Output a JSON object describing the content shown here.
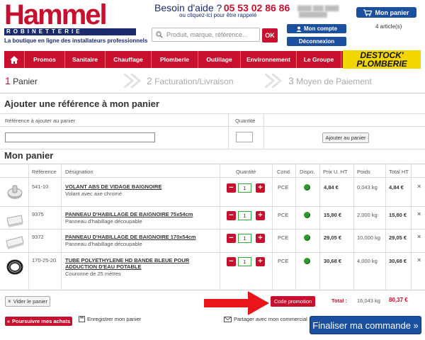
{
  "header": {
    "logo_text": "Hammel",
    "logo_sub": "ROBINETTERIE",
    "tagline": "La boutique en ligne des installateurs professionnels",
    "help_label": "Besoin d'aide ?",
    "help_phone": "05 53 02 86 86",
    "help_sub": "ou cliquez-ici pour être rappelé",
    "search_placeholder": "Produit, marque, référence...",
    "search_button": "OK",
    "account_button": "Mon compte",
    "logout_button": "Déconnexion",
    "cart_button": "Mon panier",
    "cart_count": "4 article(s)"
  },
  "nav": {
    "items": [
      "Promos",
      "Sanitaire",
      "Chauffage",
      "Plomberie",
      "Outillage",
      "Environnement",
      "Le Groupe"
    ],
    "destock_line1": "DESTOCK'",
    "destock_line2": "PLOMBERIE"
  },
  "steps": [
    {
      "num": "1",
      "label": "Panier"
    },
    {
      "num": "2",
      "label": "Facturation/Livraison"
    },
    {
      "num": "3",
      "label": "Moyen de Paiement"
    }
  ],
  "add_ref": {
    "title": "Ajouter une référence à mon panier",
    "ref_label": "Référence à ajouter au panier",
    "qty_label": "Quantité",
    "add_button": "Ajouter au panier"
  },
  "cart": {
    "title": "Mon panier",
    "columns": [
      "Référence",
      "Désignation",
      "Quantité",
      "Cond.",
      "Dispo.",
      "Prix U. HT",
      "Poids",
      "Total HT"
    ],
    "rows": [
      {
        "ref": "541-10",
        "name": "VOLANT ABS DE VIDAGE BAIGNOIRE",
        "name2": "",
        "desc": "Volant avec axe chromé",
        "qty": "1",
        "cond": "PCE",
        "price": "4,84 €",
        "weight": "0,043 kg",
        "total": "4,84 €"
      },
      {
        "ref": "9375",
        "name": "PANNEAU D'HABILLAGE DE BAIGNOIRE 75x54cm",
        "name2": "",
        "desc": "Panneau d'habillage découpable",
        "qty": "1",
        "cond": "PCE",
        "price": "15,80 €",
        "weight": "2,000 kg",
        "total": "15,80 €"
      },
      {
        "ref": "9372",
        "name": "PANNEAU D'HABILLAGE DE BAIGNOIRE 170x54cm",
        "name2": "",
        "desc": "Panneau d'habillage découpable",
        "qty": "1",
        "cond": "PCE",
        "price": "29,05 €",
        "weight": "10,000 kg",
        "total": "29,05 €"
      },
      {
        "ref": "170-25-20",
        "name": "TUBE POLYETHYLENE HD BANDE BLEUE POUR",
        "name2": "ADDUCTION D'EAU POTABLE",
        "desc": "Couronne de 25 mètres",
        "qty": "1",
        "cond": "PCE",
        "price": "30,68 €",
        "weight": "4,000 kg",
        "total": "30,68 €"
      }
    ],
    "delete_glyph": "×",
    "minus_glyph": "−",
    "plus_glyph": "+"
  },
  "footer": {
    "empty_button": "Vider le panier",
    "promo_button": "Code promotion",
    "total_label": "Total :",
    "total_weight": "16,043 kg",
    "total_price": "80,37 €",
    "continue_button": "Poursuivre mes achats",
    "save_link": "Enregistrer mon panier",
    "share_link": "Partager avec mon commercial",
    "checkout_button": "Finaliser ma commande »"
  },
  "colors": {
    "brand_red": "#c8102e",
    "brand_blue": "#1b4fa0",
    "stock_green": "#2e9a2e"
  }
}
